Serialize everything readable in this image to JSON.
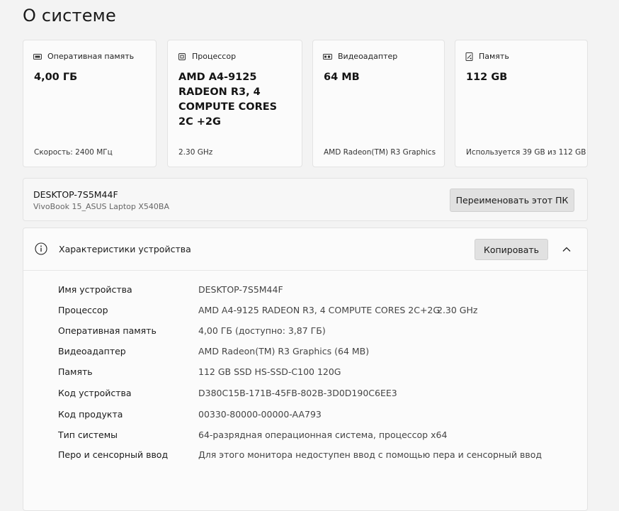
{
  "page": {
    "title": "О системе"
  },
  "cards": [
    {
      "icon": "ram-icon",
      "label": "Оперативная память",
      "value": "4,00 ГБ",
      "footer": "Скорость: 2400 МГц"
    },
    {
      "icon": "cpu-icon",
      "label": "Процессор",
      "value": "AMD A4-9125 RADEON R3, 4 COMPUTE CORES 2C +2G",
      "footer": "2.30 GHz"
    },
    {
      "icon": "gpu-icon",
      "label": "Видеоадаптер",
      "value": "64 MB",
      "footer": "AMD Radeon(TM) R3 Graphics"
    },
    {
      "icon": "storage-icon",
      "label": "Память",
      "value": "112 GB",
      "footer": "Используется 39 GB из 112 GB"
    }
  ],
  "device": {
    "name": "DESKTOP-7S5M44F",
    "model": "VivoBook 15_ASUS Laptop X540BA",
    "rename_label": "Переименовать этот ПК"
  },
  "specs": {
    "title": "Характеристики устройства",
    "copy_label": "Копировать",
    "rows": [
      {
        "label": "Имя устройства",
        "value": "DESKTOP-7S5M44F"
      },
      {
        "label": "Процессор",
        "value": "AMD A4-9125 RADEON R3, 4 COMPUTE CORES 2C+2G",
        "extra": "2.30 GHz"
      },
      {
        "label": "Оперативная память",
        "value": "4,00 ГБ (доступно: 3,87 ГБ)"
      },
      {
        "label": "Видеоадаптер",
        "value": "AMD Radeon(TM) R3 Graphics (64 MB)"
      },
      {
        "label": "Память",
        "value": "112 GB SSD HS-SSD-C100 120G"
      },
      {
        "label": "Код устройства",
        "value": "D380C15B-171B-45FB-802B-3D0D190C6EE3"
      },
      {
        "label": "Код продукта",
        "value": "00330-80000-00000-AA793"
      },
      {
        "label": "Тип системы",
        "value": "64-разрядная операционная система, процессор x64"
      },
      {
        "label": "Перо и сенсорный ввод",
        "value": "Для этого монитора недоступен ввод с помощью пера и сенсорный ввод"
      }
    ]
  }
}
